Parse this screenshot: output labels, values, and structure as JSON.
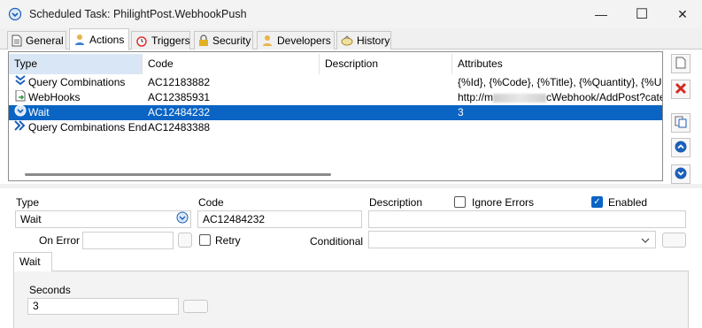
{
  "window": {
    "title": "Scheduled Task: PhilightPost.WebhookPush",
    "min_glyph": "—",
    "max_glyph": "☐",
    "close_glyph": "✕"
  },
  "tabs": [
    {
      "label": "General",
      "icon": "document-icon"
    },
    {
      "label": "Actions",
      "icon": "user-gear-icon",
      "active": true
    },
    {
      "label": "Triggers",
      "icon": "alarm-clock-icon"
    },
    {
      "label": "Security",
      "icon": "lock-icon"
    },
    {
      "label": "Developers",
      "icon": "person-icon"
    },
    {
      "label": "History",
      "icon": "history-icon"
    }
  ],
  "grid": {
    "columns": [
      "Type",
      "Code",
      "Description",
      "Attributes"
    ],
    "rows": [
      {
        "type": "Query Combinations",
        "icon": "double-chevron-down-icon",
        "code": "AC12183882",
        "description": "",
        "attributes": "{%Id}, {%Code}, {%Title}, {%Quantity}, {%Updated"
      },
      {
        "type": "WebHooks",
        "icon": "webhook-icon",
        "code": "AC12385931",
        "description": "",
        "attributes_prefix": "http://m",
        "attributes_suffix": "cWebhook/AddPost?categ"
      },
      {
        "type": "Wait",
        "icon": "wait-icon",
        "code": "AC12484232",
        "description": "",
        "attributes": "3",
        "selected": true
      },
      {
        "type": "Query Combinations End",
        "icon": "double-chevron-right-icon",
        "code": "AC12483388",
        "description": "",
        "attributes": ""
      }
    ]
  },
  "side_buttons": [
    "new-icon",
    "delete-icon",
    "copy-icon",
    "move-up-icon",
    "move-down-icon"
  ],
  "editor": {
    "type_label": "Type",
    "type_value": "Wait",
    "code_label": "Code",
    "code_value": "AC12484232",
    "description_label": "Description",
    "description_value": "",
    "ignore_errors_label": "Ignore Errors",
    "ignore_errors_checked": false,
    "enabled_label": "Enabled",
    "enabled_checked": true,
    "on_error_label": "On Error",
    "on_error_value": "",
    "retry_label": "Retry",
    "retry_checked": false,
    "conditional_label": "Conditional",
    "conditional_value": ""
  },
  "wait_tab": {
    "label": "Wait",
    "seconds_label": "Seconds",
    "seconds_value": "3"
  },
  "colors": {
    "selection": "#0a64c4",
    "accent_blue": "#1c5fb8",
    "delete_red": "#d42a1e"
  }
}
